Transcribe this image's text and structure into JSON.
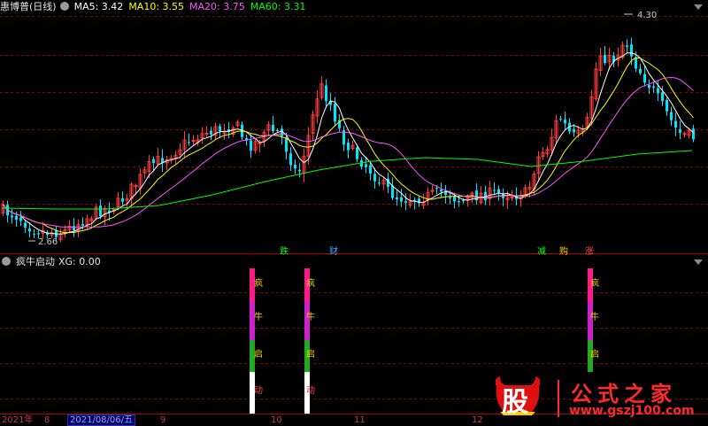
{
  "main_panel": {
    "title": "惠博普(日线)",
    "indicators": [
      {
        "label": "MA5: 3.42",
        "color": "#ffffff"
      },
      {
        "label": "MA10: 3.55",
        "color": "#ffff00"
      },
      {
        "label": "MA20: 3.75",
        "color": "#ff55ff"
      },
      {
        "label": "MA60: 3.31",
        "color": "#00ff00"
      }
    ],
    "high_label": "4.30",
    "low_label": "2.66",
    "events": [
      {
        "text": "跌",
        "color": "#00ff00"
      },
      {
        "text": "财",
        "color": "#5aa0ff"
      },
      {
        "text": "减",
        "color": "#00ff00"
      },
      {
        "text": "购",
        "color": "#ffd000"
      },
      {
        "text": "涨",
        "color": "#ff5050"
      }
    ]
  },
  "sub_panel": {
    "title": "疯牛启动",
    "value_label": "XG: 0.00",
    "signal_chars": [
      "疯",
      "牛",
      "启",
      "动"
    ]
  },
  "x_axis": {
    "labels": [
      "2021年",
      "8",
      "9",
      "10",
      "11",
      "12"
    ],
    "cursor_date": "2021/08/06/五"
  },
  "watermark": {
    "logo_char": "股",
    "title": "公式之家",
    "url": "www.gszj100.com"
  },
  "colors": {
    "up": "#ff3b3b",
    "down": "#00e5ff",
    "ma5": "#ffffff",
    "ma10": "#ffff00",
    "ma20": "#ff55ff",
    "ma60": "#00ff00",
    "grid": "#8b0000"
  }
}
